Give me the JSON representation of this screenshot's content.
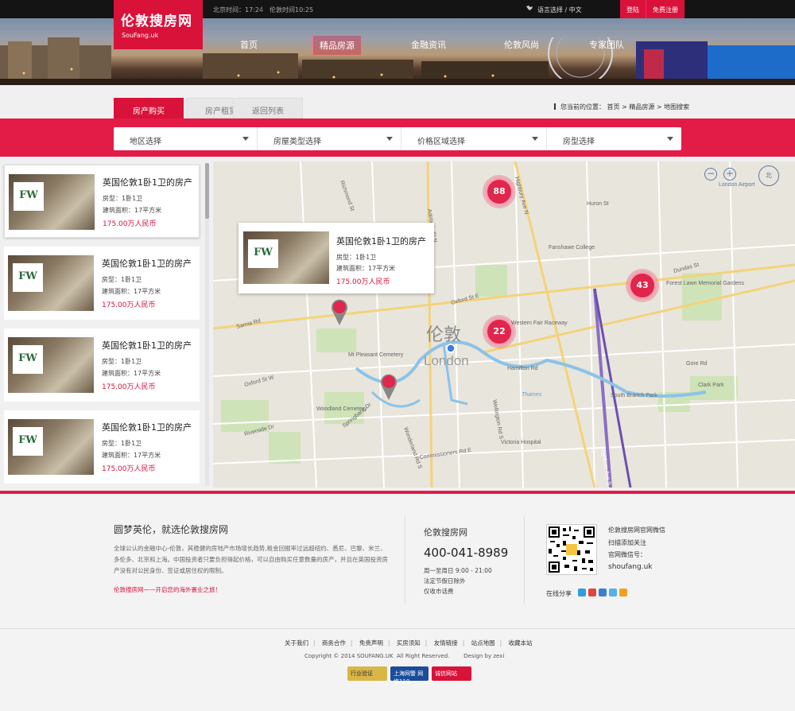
{
  "topbar": {
    "beijing_time": "北京时间：17:24",
    "london_time": "伦敦时间10:25",
    "separator": "|",
    "lang_label": "语言选择 / 中文",
    "login": "登陆",
    "register": "免费注册"
  },
  "logo": {
    "title": "伦敦搜房网",
    "subtitle": "SouFang.uk"
  },
  "nav": {
    "items": [
      "首页",
      "精品房源",
      "金融资讯",
      "伦敦风尚",
      "专家团队"
    ],
    "active": "精品房源"
  },
  "tabs": [
    "房产购买",
    "房产租赁",
    "返回列表"
  ],
  "breadcrumb": "您当前的位置：  首页  >  精品房源  >  地图搜索",
  "filters": [
    "地区选择",
    "房屋类型选择",
    "价格区域选择",
    "房型选择"
  ],
  "listings": [
    {
      "title": "英国伦敦1卧1卫的房产",
      "type": "房型：1卧1卫",
      "area": "建筑面积：17平方米",
      "price": "175.00万人民币",
      "logo": "FW"
    },
    {
      "title": "英国伦敦1卧1卫的房产",
      "type": "房型：1卧1卫",
      "area": "建筑面积：17平方米",
      "price": "175.00万人民币",
      "logo": "FW"
    },
    {
      "title": "英国伦敦1卧1卫的房产",
      "type": "房型：1卧1卫",
      "area": "建筑面积：17平方米",
      "price": "175.00万人民币",
      "logo": "FW"
    },
    {
      "title": "英国伦敦1卧1卫的房产",
      "type": "房型：1卧1卫",
      "area": "建筑面积：17平方米",
      "price": "175.00万人民币",
      "logo": "FW"
    }
  ],
  "map": {
    "popup": {
      "title": "英国伦敦1卧1卫的房产",
      "type": "房型：1卧1卫",
      "area": "建筑面积：17平方米",
      "price": "175.00万人民币",
      "logo": "FW"
    },
    "clusters": [
      "88",
      "43",
      "22"
    ],
    "city_label_cn": "伦敦",
    "city_label_en": "London",
    "road_labels": [
      "Richmond St",
      "Adelaide St N",
      "Highbury Ave N",
      "Dundas St",
      "Oxford St E",
      "Huron St",
      "Fanshawe College",
      "Thames",
      "Victoria Hospital",
      "Commissioners Rd E",
      "Wellington Rd S",
      "Hamilton Rd",
      "Gore Rd",
      "Oxford St W",
      "Riverside Dr",
      "Springbank Dr",
      "Wonderland Rd S",
      "Woodland Cemetery",
      "Mt Pleasant Cemetery",
      "South Branch Park",
      "Forest Lawn Memorial Gardens",
      "London Airport",
      "Western Fair Raceway",
      "Clark Park",
      "Sarnia Rd"
    ],
    "zoom_label": "北",
    "highway": "Highbury Ave S"
  },
  "footer": {
    "title": "圆梦英伦，就选伦敦搜房网",
    "desc": "全球公认的金融中心-伦敦，其稳健的房地产市场增长趋势,租金回报率过远超纽约、悉尼、巴黎、米兰、多伦多、北京和上海。中国投资者只要负担得起价格，可以自由购买任意数量的房产，并且在英国投资房产没有对公民身份、签证或居住权的限制。",
    "slogan": "伦敦搜房网——开启您的海外置业之旅！",
    "brand": "伦敦搜房网",
    "phone": "400-041-8989",
    "hours": [
      "周一至周日 9:00 - 21:00",
      "法定节假日除外",
      "仅收市话费"
    ],
    "wechat": [
      "伦敦搜房网官网微信",
      "扫描添加关注",
      "官网微信号：",
      "shoufang.uk"
    ],
    "share_label": "在线分享",
    "links": [
      "关于我们",
      "商务合作",
      "免责声明",
      "买房须知",
      "友情链接",
      "站点地图",
      "收藏本站"
    ],
    "copyright": "Copyright © 2014 SOUFANG.UK  All Right Reserved.        Design by zexi",
    "badges": [
      "行业验证",
      "上海网警 网络110",
      "诚信网站"
    ]
  },
  "colors": {
    "accent": "#d9123a",
    "band": "#e31b47",
    "topbar": "#141414"
  }
}
